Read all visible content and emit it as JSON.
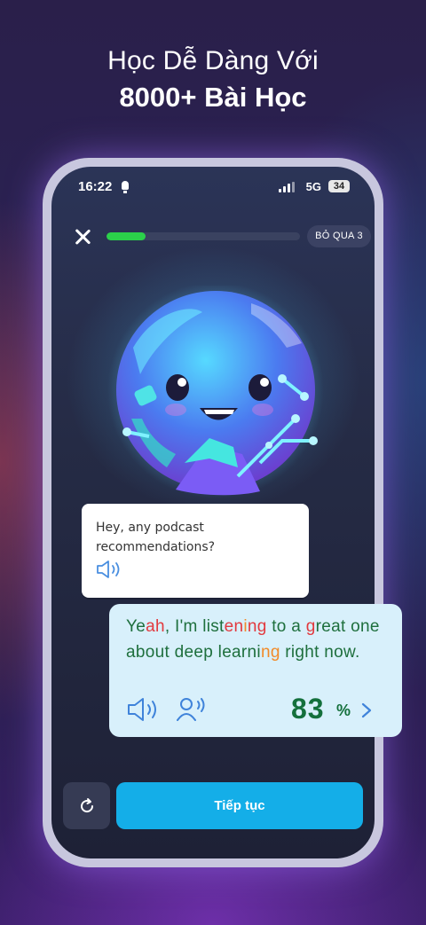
{
  "headline": {
    "line1": "Học Dễ Dàng Với",
    "line2": "8000+ Bài Học"
  },
  "status_bar": {
    "time": "16:22",
    "network": "5G",
    "battery": "34"
  },
  "lesson": {
    "progress_fraction": 0.2,
    "skip_label": "BỎ QUA 3"
  },
  "prompt_bubble": {
    "text": "Hey, any podcast recommendations?"
  },
  "answer_bubble": {
    "segments": [
      {
        "text": "Ye",
        "color": "green"
      },
      {
        "text": "ah",
        "color": "red"
      },
      {
        "text": ", I'm list",
        "color": "green"
      },
      {
        "text": "en",
        "color": "red"
      },
      {
        "text": "i",
        "color": "orange"
      },
      {
        "text": "ng",
        "color": "red"
      },
      {
        "text": " to a ",
        "color": "green"
      },
      {
        "text": "g",
        "color": "red"
      },
      {
        "text": "reat one about deep learni",
        "color": "green"
      },
      {
        "text": "ng",
        "color": "orange"
      },
      {
        "text": " right now.",
        "color": "green"
      }
    ],
    "score": "83",
    "score_unit": "%"
  },
  "buttons": {
    "continue_label": "Tiếp tục"
  },
  "colors": {
    "accent": "#14aee8",
    "progress": "#2bd04a",
    "score": "#14703c",
    "error": "#e2393e",
    "warning": "#f28a28"
  }
}
